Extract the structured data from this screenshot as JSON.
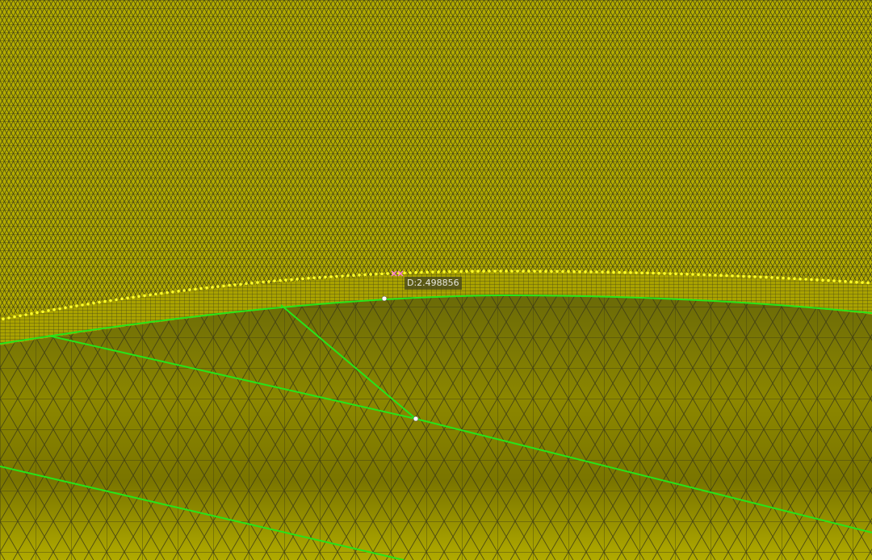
{
  "viewport": {
    "measurement": {
      "label": "D:2.498856"
    },
    "colors": {
      "upper_surface": "#b3ac00",
      "lower_surface": "#8f8a00",
      "mesh_edge": "#3b3a16",
      "feature_edge": "#27e41a",
      "node_marker": "#fdfd29",
      "pick_marker": "#ff7ed8",
      "point": "#ffffff"
    }
  }
}
